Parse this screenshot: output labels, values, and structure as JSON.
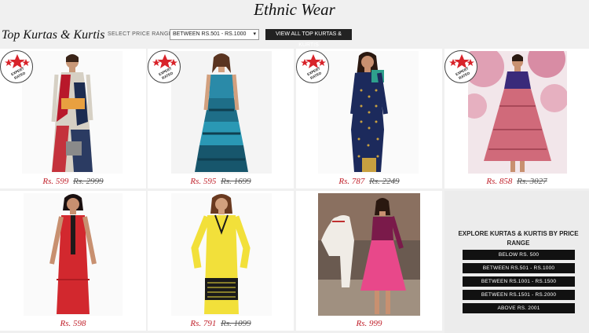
{
  "page_title": "Ethnic Wear",
  "section_title": "Top Kurtas & Kurtis",
  "price_filter": {
    "label": "SELECT PRICE RANGE:",
    "selected": "BETWEEN RS.501 - RS.1000",
    "caret": "▾"
  },
  "view_all_label": "VIEW ALL TOP KURTAS & KURTIS",
  "badge_text": "EXPERT RATED",
  "products": [
    {
      "price": "Rs. 599",
      "old_price": "Rs. 2999",
      "badge": true
    },
    {
      "price": "Rs. 595",
      "old_price": "Rs. 1699",
      "badge": true
    },
    {
      "price": "Rs. 787",
      "old_price": "Rs. 2249",
      "badge": true
    },
    {
      "price": "Rs. 858",
      "old_price": "Rs. 3027",
      "badge": true
    },
    {
      "price": "Rs. 598",
      "old_price": "",
      "badge": false
    },
    {
      "price": "Rs. 791",
      "old_price": "Rs. 1099",
      "badge": false
    },
    {
      "price": "Rs. 999",
      "old_price": "",
      "badge": false
    }
  ],
  "explore": {
    "title": "EXPLORE KURTAS & KURTIS BY PRICE RANGE",
    "ranges": [
      "BELOW RS. 500",
      "BETWEEN RS.501 - RS.1000",
      "BETWEEN RS.1001 - RS.1500",
      "BETWEEN RS.1501 - RS.2000",
      "ABOVE RS. 2001"
    ]
  },
  "colors": {
    "price_red": "#c0202a",
    "star_red": "#d8232a",
    "button_black": "#111111"
  }
}
